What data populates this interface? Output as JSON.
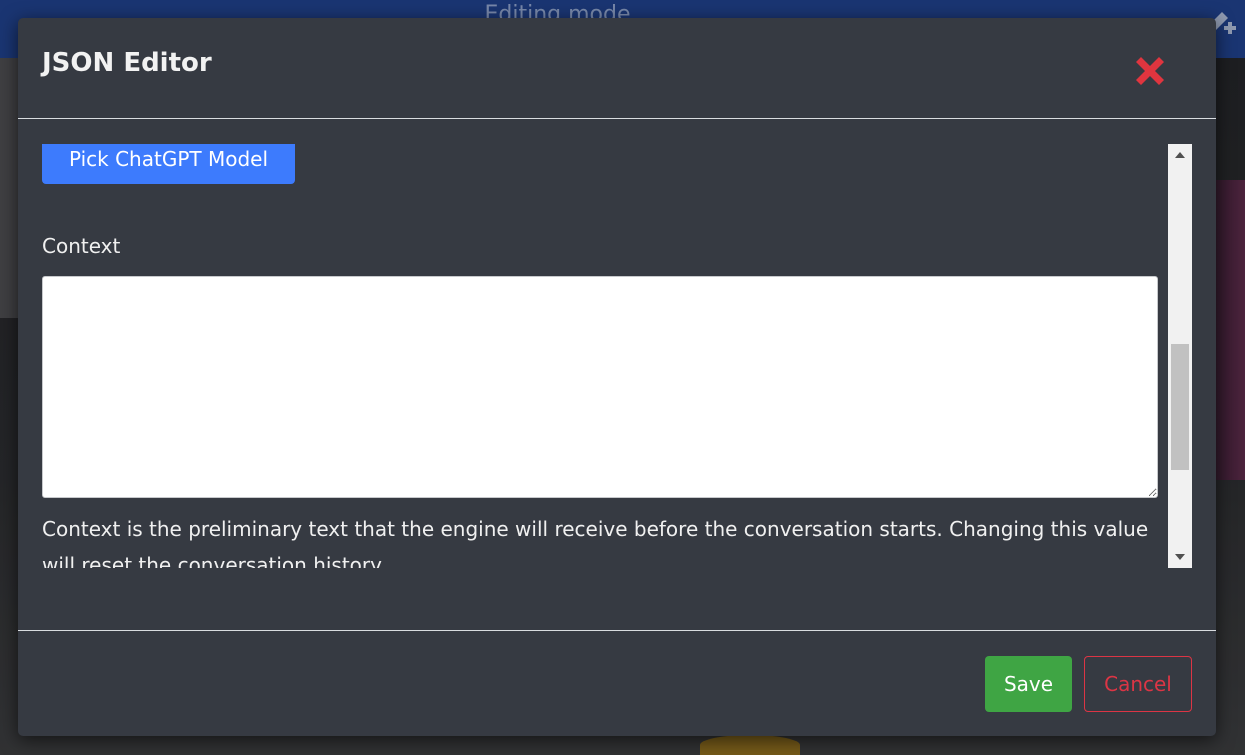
{
  "background": {
    "title": "Editing mode",
    "tool_icon": "pencil-plus-icon"
  },
  "modal": {
    "title": "JSON Editor",
    "close_icon": "close-icon",
    "body": {
      "pick_model_label": "Pick ChatGPT Model",
      "context_label": "Context",
      "context_value": "",
      "context_help": "Context is the preliminary text that the engine will receive before the conversation starts. Changing this value will reset the conversation history"
    },
    "scrollbar": {
      "position_fraction": 0.47
    },
    "footer": {
      "save_label": "Save",
      "cancel_label": "Cancel"
    }
  },
  "colors": {
    "primary": "#3d7bfd",
    "success": "#3fa544",
    "danger": "#dc3545",
    "modal_bg": "#363a42",
    "topbar": "#1f3f86"
  }
}
